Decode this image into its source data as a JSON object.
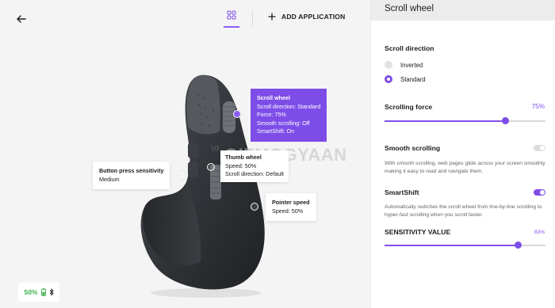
{
  "toolbar": {
    "add_application_label": "ADD APPLICATION"
  },
  "icons": {
    "back": "arrow-left-icon",
    "grid": "grid-icon",
    "plus": "plus-icon",
    "battery": "battery-icon",
    "bluetooth": "bluetooth-icon"
  },
  "colors": {
    "accent": "#7e4de8",
    "battery_green": "#3fb24a"
  },
  "tooltips": {
    "scroll_wheel": {
      "title": "Scroll wheel",
      "line1": "Scroll direction: Standard",
      "line2": "Force: 75%",
      "line3": "Smooth scrolling: Off",
      "line4": "SmartShift: On"
    },
    "thumb_wheel": {
      "title": "Thumb wheel",
      "line1": "Speed: 50%",
      "line2": "Scroll direction: Default"
    },
    "button_press": {
      "title": "Button press sensitivity",
      "line1": "Medium"
    },
    "pointer_speed": {
      "title": "Pointer speed",
      "line1": "Speed: 50%"
    }
  },
  "watermark": "GIZMOGYAAN",
  "battery": {
    "percent": "50%",
    "level": 0.5
  },
  "panel": {
    "title": "Scroll wheel",
    "scroll_direction": {
      "heading": "Scroll direction",
      "options": [
        "Inverted",
        "Standard"
      ],
      "selected": "Standard"
    },
    "scrolling_force": {
      "heading": "Scrolling force",
      "value_label": "75%",
      "value": 0.75
    },
    "smooth_scrolling": {
      "heading": "Smooth scrolling",
      "enabled": false,
      "description": "With smooth scrolling, web pages glide across your screen smoothly making it easy to read and navigate them."
    },
    "smartshift": {
      "heading": "SmartShift",
      "enabled": true,
      "description": "Automatically switches the scroll wheel from line-by-line scrolling to hyper-fast scrolling when you scroll faster."
    },
    "sensitivity": {
      "heading": "SENSITIVITY VALUE",
      "value_label": "83%",
      "value": 0.83
    }
  }
}
